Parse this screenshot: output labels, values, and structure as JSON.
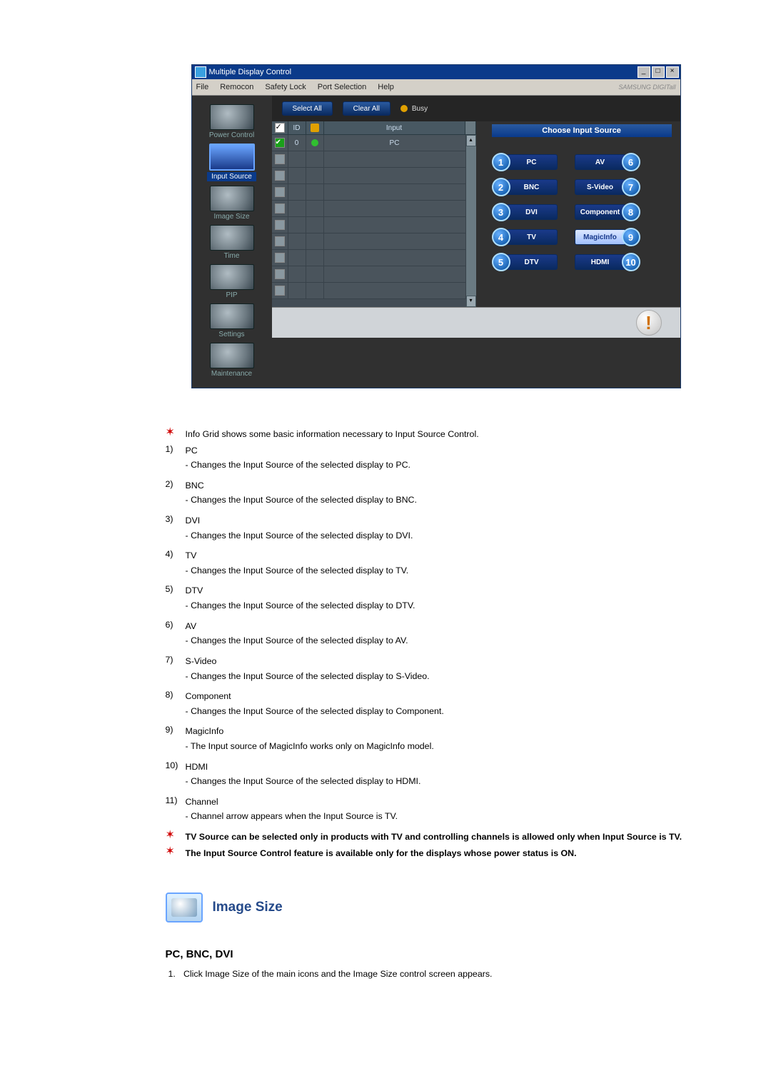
{
  "appWindow": {
    "title": "Multiple Display Control",
    "menus": [
      "File",
      "Remocon",
      "Safety Lock",
      "Port Selection",
      "Help"
    ],
    "brand": "SAMSUNG DIGITall",
    "windowButtons": {
      "min": "_",
      "max": "□",
      "close": "×"
    }
  },
  "sidebar": {
    "items": [
      {
        "label": "Power Control"
      },
      {
        "label": "Input Source",
        "active": true
      },
      {
        "label": "Image Size"
      },
      {
        "label": "Time"
      },
      {
        "label": "PIP"
      },
      {
        "label": "Settings"
      },
      {
        "label": "Maintenance"
      }
    ]
  },
  "toolbar": {
    "selectAll": "Select All",
    "clearAll": "Clear All",
    "busy": "Busy"
  },
  "grid": {
    "headers": {
      "check": "☑",
      "id": "ID",
      "bolt": "",
      "input": "Input"
    },
    "dataRow": {
      "id": "0",
      "input": "PC"
    },
    "emptyRows": 9
  },
  "panel": {
    "title": "Choose Input Source",
    "left": [
      {
        "n": "1",
        "label": "PC"
      },
      {
        "n": "2",
        "label": "BNC"
      },
      {
        "n": "3",
        "label": "DVI"
      },
      {
        "n": "4",
        "label": "TV"
      },
      {
        "n": "5",
        "label": "DTV"
      }
    ],
    "right": [
      {
        "n": "6",
        "label": "AV"
      },
      {
        "n": "7",
        "label": "S-Video"
      },
      {
        "n": "8",
        "label": "Component"
      },
      {
        "n": "9",
        "label": "MagicInfo",
        "invert": true
      },
      {
        "n": "10",
        "label": "HDMI"
      }
    ]
  },
  "status": {
    "alert": "!"
  },
  "doc": {
    "starIntro": "Info Grid shows some basic information necessary to Input Source Control.",
    "items": [
      {
        "n": "1)",
        "t": "PC",
        "s": "Changes the Input Source of the selected display to PC."
      },
      {
        "n": "2)",
        "t": "BNC",
        "s": "Changes the Input Source of the selected display to BNC."
      },
      {
        "n": "3)",
        "t": "DVI",
        "s": "Changes the Input Source of the selected display to DVI."
      },
      {
        "n": "4)",
        "t": "TV",
        "s": "Changes the Input Source of the selected display to TV."
      },
      {
        "n": "5)",
        "t": "DTV",
        "s": "Changes the Input Source of the selected display to DTV."
      },
      {
        "n": "6)",
        "t": "AV",
        "s": "Changes the Input Source of the selected display to AV."
      },
      {
        "n": "7)",
        "t": "S-Video",
        "s": "Changes the Input Source of the selected display to S-Video."
      },
      {
        "n": "8)",
        "t": "Component",
        "s": "Changes the Input Source of the selected display to Component."
      },
      {
        "n": "9)",
        "t": "MagicInfo",
        "s": "The Input source of MagicInfo works only on MagicInfo model."
      },
      {
        "n": "10)",
        "t": "HDMI",
        "s": "Changes the Input Source of the selected display to HDMI."
      },
      {
        "n": "11)",
        "t": "Channel",
        "s": "Channel arrow appears when the Input Source is TV."
      }
    ],
    "note1": "TV Source can be selected only in products with TV and controlling channels is allowed only when Input Source is TV.",
    "note2": "The Input Source Control feature is available only for the displays whose power status is ON.",
    "section": "Image Size",
    "subhead": "PC, BNC, DVI",
    "step1_n": "1.",
    "step1": "Click Image Size of the main icons and the Image Size control screen appears."
  }
}
